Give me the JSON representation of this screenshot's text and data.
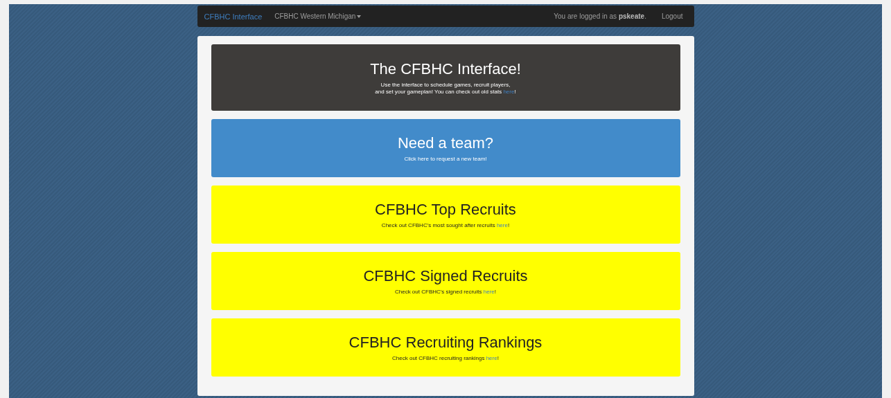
{
  "navbar": {
    "brand": "CFBHC Interface",
    "team_menu": {
      "label": "CFBHC Western Michigan",
      "expanded": false
    },
    "login_prefix": "You are logged in as ",
    "username": "pskeate",
    "login_suffix": ".",
    "logout": "Logout"
  },
  "cards": [
    {
      "kind": "dark",
      "title": "The CFBHC Interface!",
      "lines": [
        {
          "text": "Use the interface to schedule games, recruit players,"
        },
        {
          "text": "and set your gameplan! You can check out old stats ",
          "link": "here",
          "after": "!"
        }
      ]
    },
    {
      "kind": "blue",
      "title": "Need a team?",
      "lines": [
        {
          "text": "Click here to request a new team!"
        }
      ]
    },
    {
      "kind": "yellow",
      "title": "CFBHC Top Recruits",
      "lines": [
        {
          "text": "Check out CFBHC's most sought after recruits ",
          "link": "here",
          "after": "!"
        }
      ]
    },
    {
      "kind": "yellow",
      "title": "CFBHC Signed Recruits",
      "lines": [
        {
          "text": "Check out CFBHC's signed recruits ",
          "link": "here",
          "after": "!"
        }
      ]
    },
    {
      "kind": "yellow",
      "title": "CFBHC Recruiting Rankings",
      "lines": [
        {
          "text": "Check out CFBHC recruiting rankings ",
          "link": "here",
          "after": "!"
        }
      ]
    }
  ]
}
